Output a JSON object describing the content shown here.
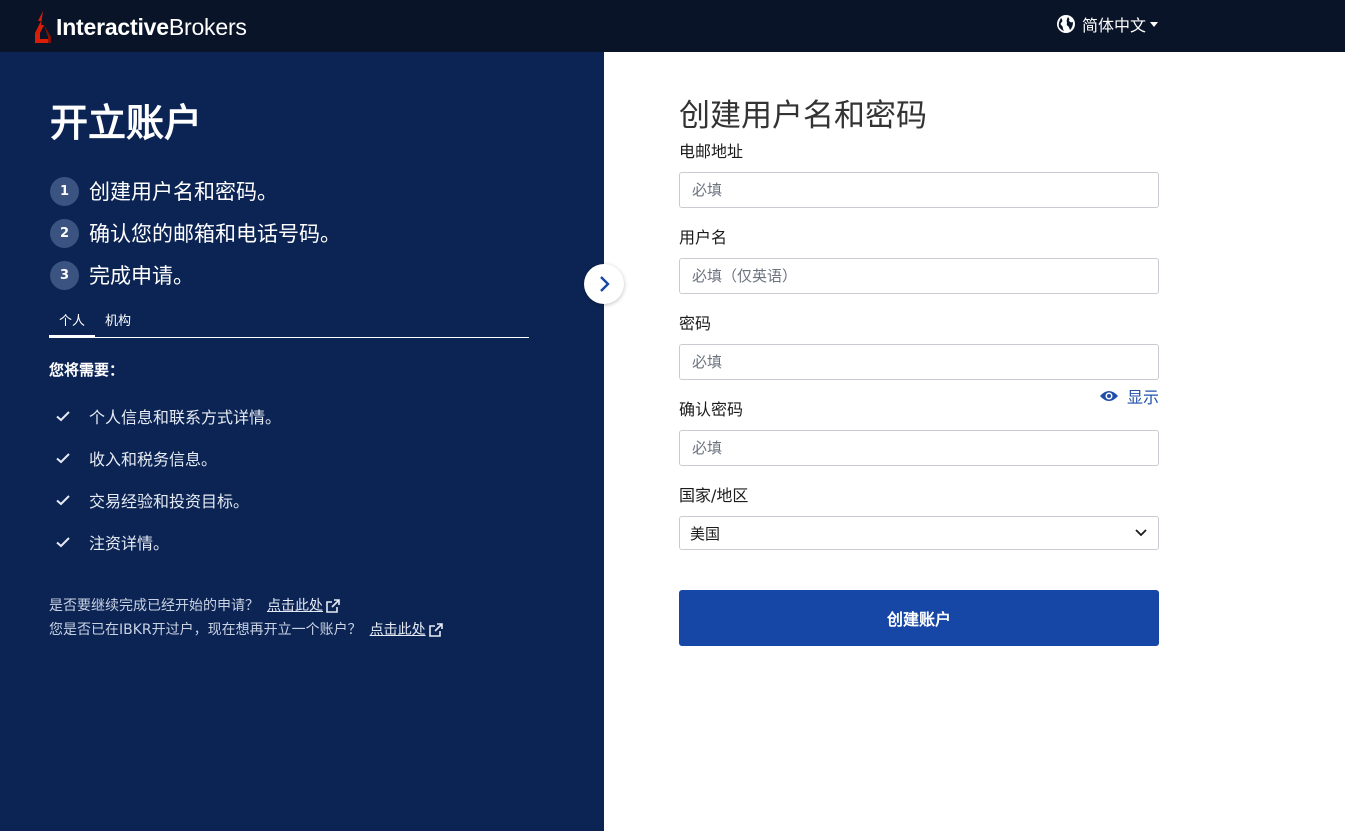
{
  "brand": {
    "name_bold": "Interactive",
    "name_light": "Brokers",
    "logo_color": "#d81e05"
  },
  "header": {
    "language": "简体中文"
  },
  "left": {
    "title": "开立账户",
    "steps": [
      {
        "num": "1",
        "text": "创建用户名和密码。"
      },
      {
        "num": "2",
        "text": "确认您的邮箱和电话号码。"
      },
      {
        "num": "3",
        "text": "完成申请。"
      }
    ],
    "tabs": [
      {
        "label": "个人",
        "active": true
      },
      {
        "label": "机构",
        "active": false
      }
    ],
    "need_title": "您将需要：",
    "checklist": [
      "个人信息和联系方式详情。",
      "收入和税务信息。",
      "交易经验和投资目标。",
      "注资详情。"
    ],
    "links": [
      {
        "question": "是否要继续完成已经开始的申请？",
        "link": "点击此处"
      },
      {
        "question": "您是否已在IBKR开过户，现在想再开立一个账户？",
        "link": "点击此处"
      }
    ]
  },
  "form": {
    "title": "创建用户名和密码",
    "email_label": "电邮地址",
    "email_placeholder": "必填",
    "username_label": "用户名",
    "username_placeholder": "必填（仅英语）",
    "password_label": "密码",
    "password_placeholder": "必填",
    "show_label": "显示",
    "confirm_label": "确认密码",
    "confirm_placeholder": "必填",
    "country_label": "国家/地区",
    "country_value": "美国",
    "submit_label": "创建账户"
  },
  "colors": {
    "topbar": "#0a1428",
    "left_panel": "#0b2454",
    "primary": "#1747a6"
  }
}
